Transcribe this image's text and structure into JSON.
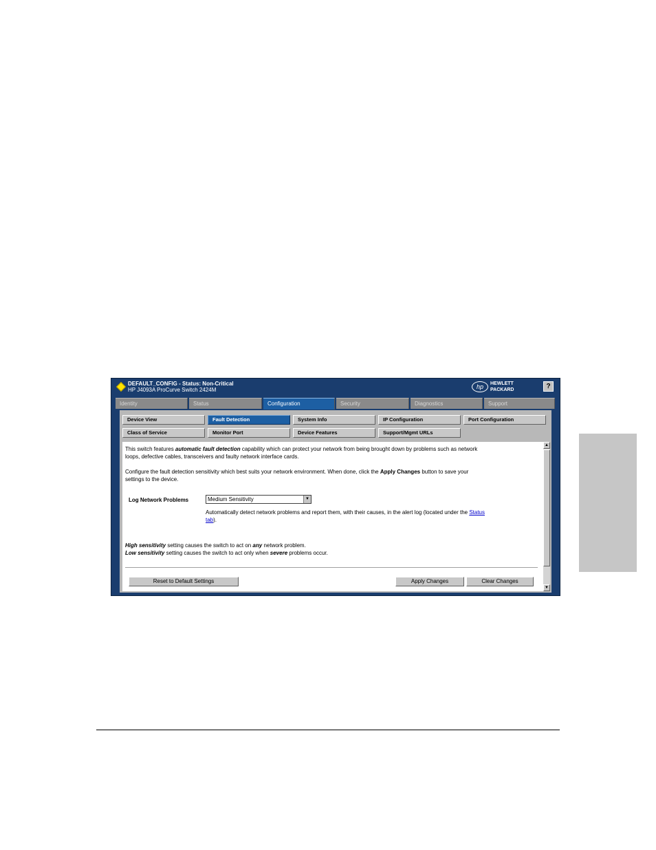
{
  "header": {
    "status_line": "DEFAULT_CONFIG - Status: Non-Critical",
    "device_line": "HP J4093A ProCurve Switch 2424M",
    "brand_line1": "HEWLETT",
    "brand_line2": "PACKARD",
    "help_label": "?",
    "hp_mark": "hp"
  },
  "tabs": [
    "Identity",
    "Status",
    "Configuration",
    "Security",
    "Diagnostics",
    "Support"
  ],
  "subtabs": {
    "row1": [
      "Device View",
      "Fault Detection",
      "System Info",
      "IP Configuration",
      "Port Configuration"
    ],
    "row2": [
      "Class of Service",
      "Monitor Port",
      "Device Features",
      "Support/Mgmt URLs"
    ]
  },
  "content": {
    "intro_pre": "This switch features ",
    "intro_bold": "automatic fault detection",
    "intro_post": " capability which can protect your network from being brought down by problems such as network",
    "intro_line2": "loops, defective cables, transceivers and faulty network interface cards.",
    "config_pre": "Configure the fault detection sensitivity which best suits your network environment. When done, click the ",
    "config_bold": "Apply Changes",
    "config_post": " button to save your",
    "config_line2": "settings to the device.",
    "field_label": "Log Network Problems",
    "select_value": "Medium Sensitivity",
    "help_pre": "Automatically detect network problems and report them, with their causes, in the alert log (located under the ",
    "help_link1": "Status",
    "help_link2": "tab",
    "help_post": ").",
    "high_bold": "High sensitivity",
    "high_mid": " setting causes the switch to act on ",
    "high_any": "any",
    "high_end": " network problem.",
    "low_bold": "Low sensitivity",
    "low_mid": " setting causes the switch to act only when ",
    "low_severe": "severe",
    "low_end": " problems occur."
  },
  "buttons": {
    "reset": "Reset to Default Settings",
    "apply": "Apply Changes",
    "clear": "Clear Changes"
  },
  "icons": {
    "status": "yellow-diamond-icon",
    "scroll_up": "scroll-up-arrow-icon",
    "scroll_down": "scroll-down-arrow-icon",
    "dropdown": "dropdown-arrow-icon"
  },
  "colors": {
    "window_bg": "#1a3d6e",
    "active_tab": "#1d5fa3",
    "status_diamond": "#ffe400"
  }
}
